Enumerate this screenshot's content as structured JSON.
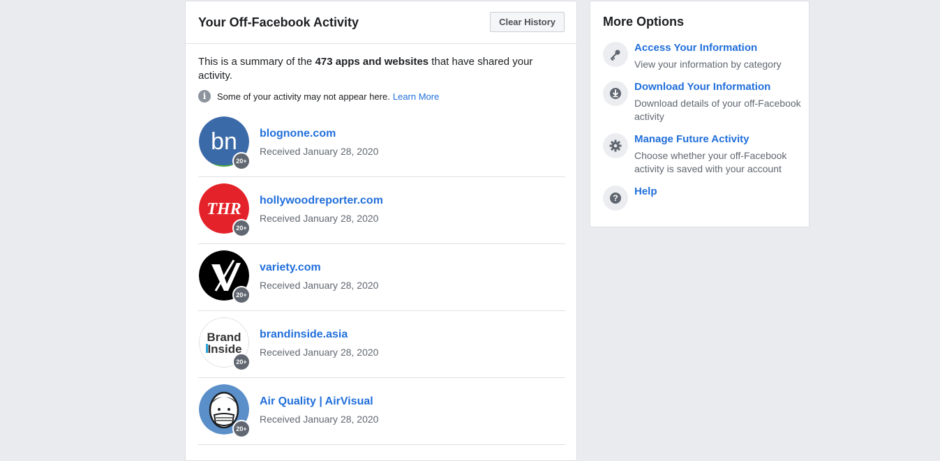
{
  "main": {
    "title": "Your Off-Facebook Activity",
    "clear_button": "Clear History",
    "summary_prefix": "This is a summary of the ",
    "summary_bold": "473 apps and websites",
    "summary_suffix": " that have shared your activity.",
    "note_text": "Some of your activity may not appear here.",
    "note_link": "Learn More"
  },
  "activities": [
    {
      "name": "blognone.com",
      "date": "Received January 28, 2020",
      "badge": "20+",
      "logo_text": "bn",
      "logo_color": "#3b6aa8"
    },
    {
      "name": "hollywoodreporter.com",
      "date": "Received January 28, 2020",
      "badge": "20+",
      "logo_text": "THR",
      "logo_color": "#e4222a"
    },
    {
      "name": "variety.com",
      "date": "Received January 28, 2020",
      "badge": "20+",
      "logo_text": "V",
      "logo_color": "#000000"
    },
    {
      "name": "brandinside.asia",
      "date": "Received January 28, 2020",
      "badge": "20+",
      "logo_text": "Brand Inside",
      "logo_color": "#ffffff"
    },
    {
      "name": "Air Quality | AirVisual",
      "date": "Received January 28, 2020",
      "badge": "20+",
      "logo_text": "",
      "logo_color": "#5b8fc9"
    }
  ],
  "side": {
    "title": "More Options",
    "options": [
      {
        "label": "Access Your Information",
        "desc": "View your information by category",
        "icon": "key-icon"
      },
      {
        "label": "Download Your Information",
        "desc": "Download details of your off-Facebook activity",
        "icon": "download-icon"
      },
      {
        "label": "Manage Future Activity",
        "desc": "Choose whether your off-Facebook activity is saved with your account",
        "icon": "gear-icon"
      },
      {
        "label": "Help",
        "desc": "",
        "icon": "question-icon"
      }
    ]
  }
}
